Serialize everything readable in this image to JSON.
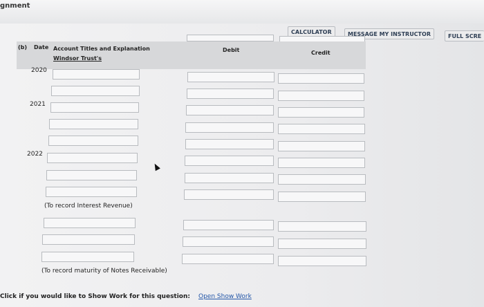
{
  "app": {
    "title_fragment": "gnment"
  },
  "toolbar": {
    "calculator": "CALCULATOR",
    "message_instructor": "MESSAGE MY INSTRUCTOR",
    "full_screen": "FULL SCRE"
  },
  "table": {
    "part_label": "(b)",
    "col_date": "Date",
    "col_account": "Account Titles and Explanation",
    "col_debit": "Debit",
    "col_credit": "Credit",
    "company": "Windsor Trust's"
  },
  "years": [
    "2020",
    "2021",
    "2022"
  ],
  "notes": {
    "interest": "(To record Interest Revenue)",
    "maturity": "(To record maturity of Notes Receivable)"
  },
  "footer": {
    "prompt": "Click if you would like to Show Work for this question:",
    "link": "Open Show Work"
  }
}
